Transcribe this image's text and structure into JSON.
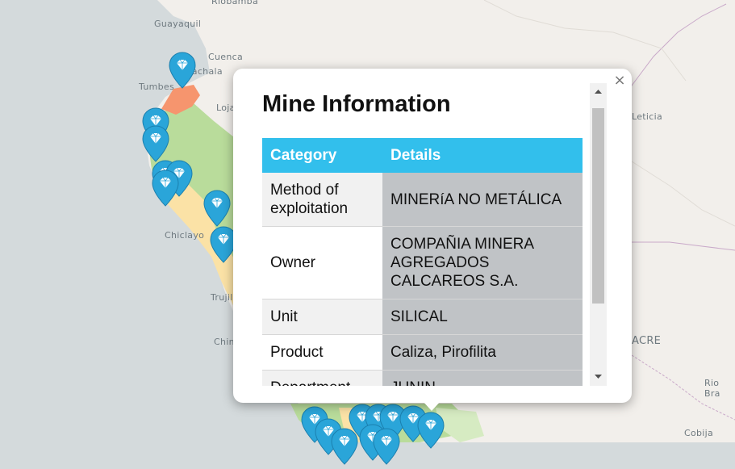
{
  "map": {
    "cities": [
      {
        "name": "Riobamba",
        "id": "riobamba"
      },
      {
        "name": "Guayaquil",
        "id": "guayaquil"
      },
      {
        "name": "Cuenca",
        "id": "cuenca"
      },
      {
        "name": "Machala",
        "id": "machala"
      },
      {
        "name": "Tumbes",
        "id": "tumbes"
      },
      {
        "name": "Loja",
        "id": "loja"
      },
      {
        "name": "Chiclayo",
        "id": "chiclayo"
      },
      {
        "name": "Trujillo",
        "id": "trujillo"
      },
      {
        "name": "Chimbote",
        "id": "chimbote"
      },
      {
        "name": "ACRE",
        "id": "acre"
      },
      {
        "name": "Rio Bra",
        "id": "rio-branco"
      },
      {
        "name": "Cobija",
        "id": "cobija"
      },
      {
        "name": "Leticia",
        "id": "leticia"
      }
    ],
    "colors": {
      "ocean": "#d4dadc",
      "land": "#f2efeb",
      "region_green": "#b9dc9b",
      "region_yellow": "#fbe2a6",
      "region_orange": "#f6956e",
      "marker": "#2aa5d9"
    }
  },
  "popup": {
    "title": "Mine Information",
    "close_label": "×",
    "table": {
      "headers": [
        "Category",
        "Details"
      ],
      "rows": [
        {
          "category": "Method of exploitation",
          "details": "MINERíA NO METÁLICA"
        },
        {
          "category": "Owner",
          "details": "COMPAÑIA MINERA AGREGADOS CALCAREOS S.A."
        },
        {
          "category": "Unit",
          "details": "SILICAL"
        },
        {
          "category": "Product",
          "details": "Caliza, Pirofilita"
        },
        {
          "category": "Department",
          "details": "JUNIN"
        }
      ]
    }
  }
}
